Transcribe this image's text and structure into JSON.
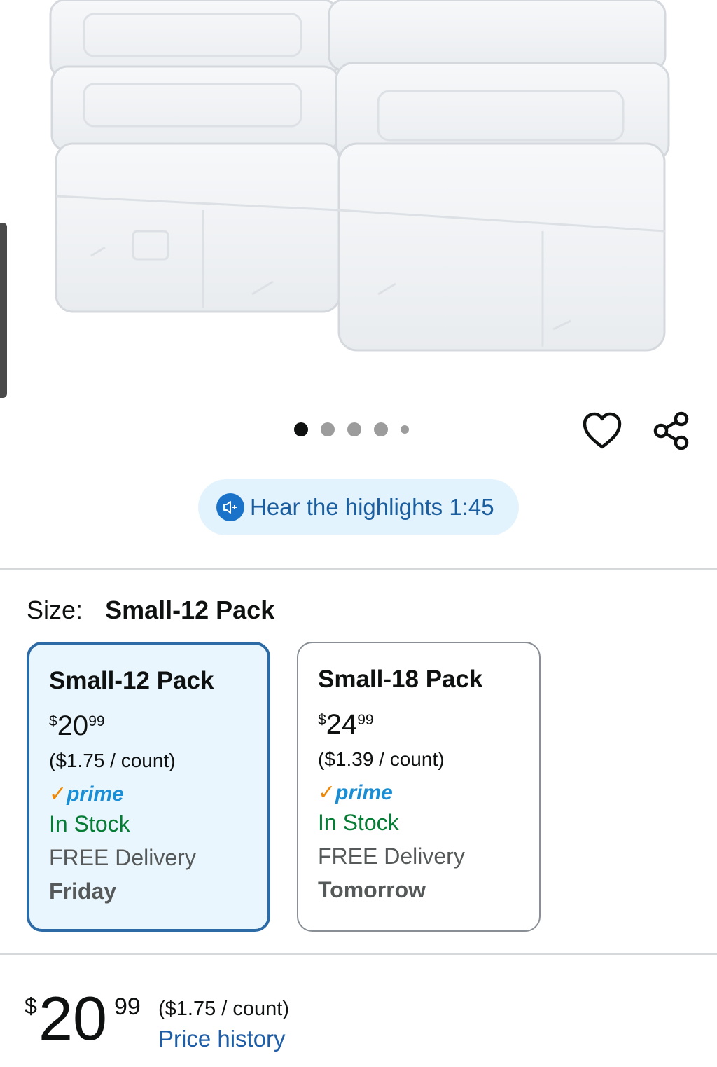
{
  "product_image": {
    "alt": "clear plastic storage boxes"
  },
  "carousel": {
    "count": 5,
    "active_index": 0
  },
  "actions": {
    "wishlist_icon": "heart-icon",
    "share_icon": "share-icon"
  },
  "audio": {
    "label": "Hear the highlights 1:45",
    "icon": "audio-icon"
  },
  "size": {
    "label": "Size:",
    "selected": "Small-12 Pack",
    "options": [
      {
        "title": "Small-12 Pack",
        "price_symbol": "$",
        "price_whole": "20",
        "price_fraction": "99",
        "unit_price": "($1.75 / count)",
        "prime": "prime",
        "stock": "In Stock",
        "delivery": "FREE Delivery",
        "delivery_day": "Friday"
      },
      {
        "title": "Small-18 Pack",
        "price_symbol": "$",
        "price_whole": "24",
        "price_fraction": "99",
        "unit_price": "($1.39 / count)",
        "prime": "prime",
        "stock": "In Stock",
        "delivery": "FREE Delivery",
        "delivery_day": "Tomorrow"
      }
    ]
  },
  "price": {
    "symbol": "$",
    "whole": "20",
    "fraction": "99",
    "unit_price": "($1.75 / count)",
    "history_link": "Price history"
  },
  "colors": {
    "selected_border": "#2c6ba5",
    "selected_bg": "#eaf6fd",
    "in_stock": "#067d35",
    "link": "#1e5ea8",
    "prime_blue": "#1a8ed5",
    "prime_check": "#f08804"
  }
}
